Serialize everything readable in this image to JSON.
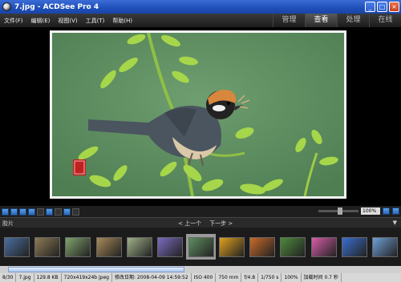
{
  "window": {
    "title": "7.jpg - ACDSee Pro 4"
  },
  "window_buttons": {
    "minimize": "_",
    "maximize": "□",
    "close": "×"
  },
  "menu": {
    "items": [
      "文件(F)",
      "编辑(E)",
      "视图(V)",
      "工具(T)",
      "帮助(H)"
    ]
  },
  "modes": [
    {
      "label": "管理",
      "active": false
    },
    {
      "label": "查看",
      "active": true
    },
    {
      "label": "处理",
      "active": false
    },
    {
      "label": "在线",
      "active": false
    }
  ],
  "toolbar": {
    "zoom_value": "100%"
  },
  "filmstrip": {
    "label": "胶片",
    "prev": "< 上一个",
    "next": "下一步 >",
    "collapse": "▼",
    "thumbs": [
      {
        "name": "thumb-1",
        "color": "#4a6fa0",
        "selected": false
      },
      {
        "name": "thumb-2",
        "color": "#8c7a55",
        "selected": false
      },
      {
        "name": "thumb-3",
        "color": "#7fa36c",
        "selected": false
      },
      {
        "name": "thumb-4",
        "color": "#a88a5a",
        "selected": false
      },
      {
        "name": "thumb-5",
        "color": "#9fb089",
        "selected": false
      },
      {
        "name": "thumb-6",
        "color": "#7b6bbf",
        "selected": false
      },
      {
        "name": "thumb-7",
        "color": "#5e8e60",
        "selected": true
      },
      {
        "name": "thumb-8",
        "color": "#e0a020",
        "selected": false
      },
      {
        "name": "thumb-9",
        "color": "#c86a2a",
        "selected": false
      },
      {
        "name": "thumb-10",
        "color": "#4e8a3c",
        "selected": false
      },
      {
        "name": "thumb-11",
        "color": "#d85ea8",
        "selected": false
      },
      {
        "name": "thumb-12",
        "color": "#3a6ed0",
        "selected": false
      },
      {
        "name": "thumb-13",
        "color": "#6fa0d8",
        "selected": false
      }
    ]
  },
  "scrollbar": {
    "position_fraction": 0.02,
    "visible_fraction": 0.44
  },
  "status": {
    "cells": [
      "8/30",
      "7.jpg",
      "129.8 KB",
      "720x419x24b jpeg",
      "修改日期: 2008-04-09 14:59:52",
      "ISO 400",
      "750 mm",
      "f/4.8",
      "1/750 s",
      "100%",
      "加载时间 0.7 秒"
    ]
  },
  "colors": {
    "photo_background": "#5e8e60",
    "title_bar": "#2d5fcf",
    "active_mode": "#5a5a5a"
  }
}
